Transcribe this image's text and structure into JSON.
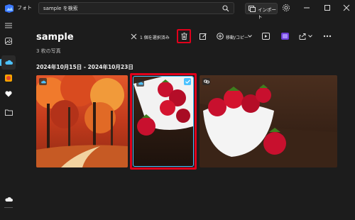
{
  "app": {
    "title": "フォト"
  },
  "search": {
    "value": "sample を検索"
  },
  "header_actions": {
    "import_label": "インポート"
  },
  "page": {
    "title": "sample",
    "count": "3 枚の写真",
    "date_range": "2024年10月15日 - 2024年10月23日"
  },
  "toolbar": {
    "selected_label": "1 個を選択済み",
    "move_copy_label": "移動/コピー"
  },
  "colors": {
    "accent": "#4cc2ff",
    "highlight": "#e0001b",
    "background": "#1c1c1c"
  },
  "icons": {
    "logo": "photos-logo-icon",
    "search": "search-icon",
    "import": "import-icon",
    "settings": "gear-icon",
    "rail": [
      "menu-icon",
      "image-icon",
      "cloud-icon",
      "onedrive-icon",
      "heart-icon",
      "folder-icon",
      "cloud-bottom-icon"
    ],
    "toolbar": [
      "close-icon",
      "trash-icon",
      "edit-icon",
      "move-icon",
      "slideshow-icon",
      "clipchamp-icon",
      "share-icon",
      "more-icon"
    ]
  },
  "photos": [
    {
      "subject": "autumn-forest-path",
      "badge": "cloud-icon"
    },
    {
      "subject": "strawberries-tall",
      "badge": "cloud-icon",
      "selected": true
    },
    {
      "subject": "strawberries-bowl",
      "badge": "link-icon"
    }
  ]
}
